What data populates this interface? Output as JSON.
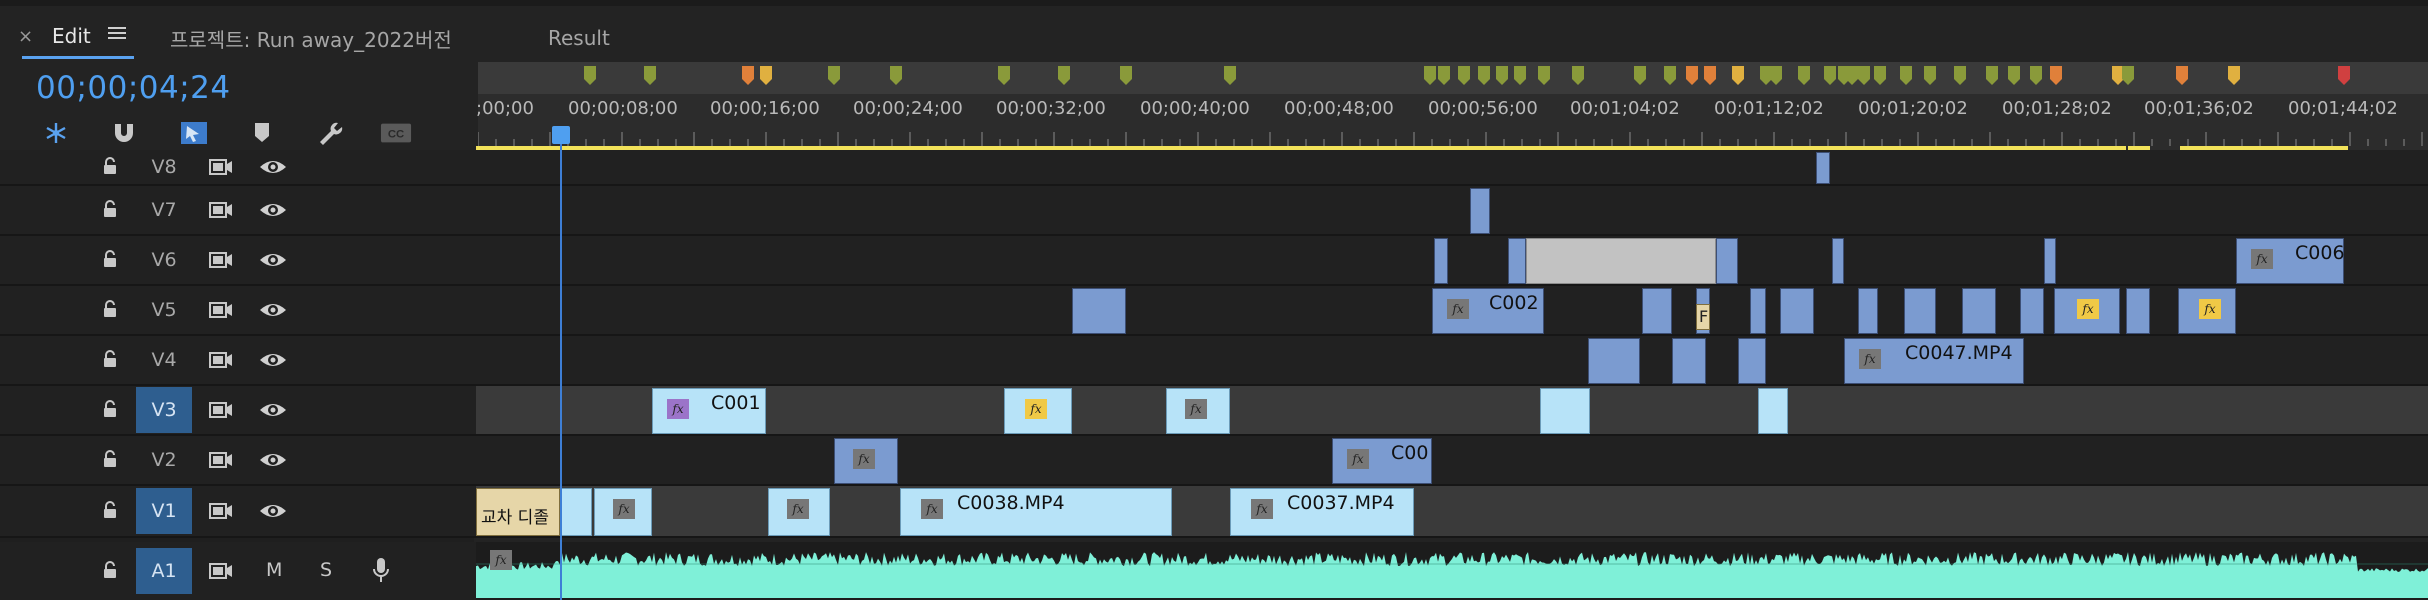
{
  "tabs": {
    "close_icon": "×",
    "edit_label": "Edit",
    "project_label": "프로젝트: Run away_2022버전",
    "result_label": "Result"
  },
  "timecode": "00;00;04;24",
  "toolbar": {
    "icons": [
      "snap-nest-icon",
      "magnet-icon",
      "linked-selection-icon",
      "marker-icon",
      "wrench-icon",
      "captions-icon"
    ],
    "captions_text": "CC"
  },
  "ruler": {
    "labels": [
      "00;00",
      "00;00;08;00",
      "00;00;16;00",
      "00;00;24;00",
      "00;00;32;00",
      "00;00;40;00",
      "00;00;48;00",
      "00;00;56;00",
      "00;01;04;02",
      "00;01;12;02",
      "00;01;20;02",
      "00;01;28;02",
      "00;01;36;02",
      "00;01;44;02"
    ],
    "first_label_display": ";00;00"
  },
  "tracks": {
    "video": [
      {
        "id": "V8",
        "label": "V8",
        "active": false
      },
      {
        "id": "V7",
        "label": "V7",
        "active": false
      },
      {
        "id": "V6",
        "label": "V6",
        "active": false
      },
      {
        "id": "V5",
        "label": "V5",
        "active": false
      },
      {
        "id": "V4",
        "label": "V4",
        "active": false
      },
      {
        "id": "V3",
        "label": "V3",
        "active": true
      },
      {
        "id": "V2",
        "label": "V2",
        "active": false
      },
      {
        "id": "V1",
        "label": "V1",
        "active": true
      }
    ],
    "audio": [
      {
        "id": "A1",
        "label": "A1",
        "active": true,
        "m": "M",
        "s": "S"
      }
    ]
  },
  "clips": {
    "c006": "C006",
    "c002": "C002",
    "c0047": "C0047.MP4",
    "c001": "C001",
    "c00": "C00",
    "c0038": "C0038.MP4",
    "c0037": "C0037.MP4",
    "korean_clip": "교차 디졸",
    "fx_label": "fx",
    "tan_label": "F"
  },
  "colors": {
    "accent": "#4f9ff0",
    "clip_blue": "#7b9bd0",
    "clip_light": "#b7e3f8",
    "audio": "#7ff0d8",
    "marker_green": "#8a9a3a",
    "marker_orange": "#e0803a",
    "marker_yellow": "#e0b040",
    "marker_red": "#d04040"
  }
}
